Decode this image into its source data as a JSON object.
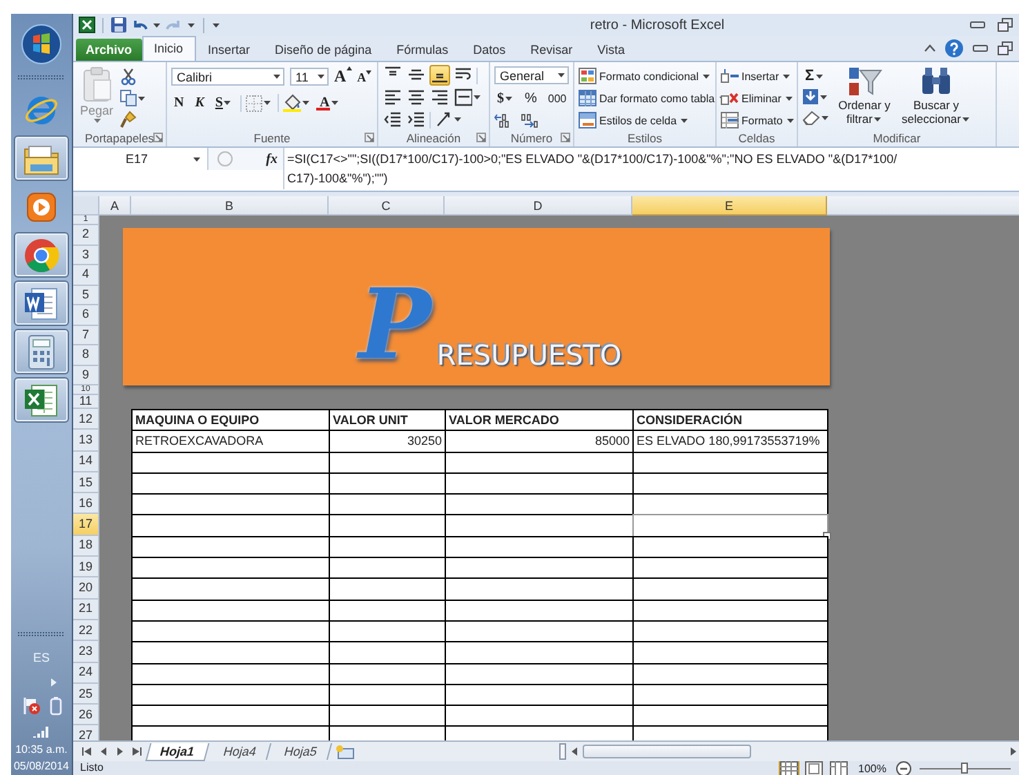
{
  "taskbar": {
    "items": [
      {
        "kind": "start",
        "running": false
      },
      {
        "kind": "browser",
        "running": false
      },
      {
        "kind": "folder",
        "running": true
      },
      {
        "kind": "media",
        "running": false
      },
      {
        "kind": "chrome",
        "running": true
      },
      {
        "kind": "word",
        "running": true
      },
      {
        "kind": "calculator",
        "running": true
      },
      {
        "kind": "spreadsheet",
        "running": true
      }
    ],
    "tray": {
      "language": "ES",
      "time": "10:35 a.m.",
      "date": "05/08/2014"
    }
  },
  "title_bar": {
    "title": "retro - Microsoft Excel",
    "quick_access": [
      {
        "kind": "save",
        "disabled": false
      },
      {
        "kind": "undo",
        "disabled": false
      },
      {
        "kind": "redo",
        "disabled": true
      }
    ]
  },
  "ribbon_tabs": [
    {
      "label": "Archivo",
      "kind": "file",
      "selected": false
    },
    {
      "label": "Inicio",
      "kind": "tab",
      "selected": true
    },
    {
      "label": "Insertar",
      "kind": "tab",
      "selected": false
    },
    {
      "label": "Diseño de página",
      "kind": "tab",
      "selected": false
    },
    {
      "label": "Fórmulas",
      "kind": "tab",
      "selected": false
    },
    {
      "label": "Datos",
      "kind": "tab",
      "selected": false
    },
    {
      "label": "Revisar",
      "kind": "tab",
      "selected": false
    },
    {
      "label": "Vista",
      "kind": "tab",
      "selected": false
    }
  ],
  "ribbon": {
    "clipboard": {
      "paste": "Pegar",
      "paste_disabled": true,
      "label": "Portapapeles"
    },
    "font": {
      "name": "Calibri",
      "size": "11",
      "grow": "A",
      "shrink": "A",
      "bold": "N",
      "italic": "K",
      "underline": "S",
      "color_letter": "A",
      "label": "Fuente"
    },
    "alignment": {
      "buttons": [
        {
          "kind": "top",
          "selected": false
        },
        {
          "kind": "middle",
          "selected": false
        },
        {
          "kind": "bottom",
          "selected": true
        },
        {
          "kind": "wrap",
          "selected": false
        },
        {
          "kind": "left",
          "selected": false
        },
        {
          "kind": "center",
          "selected": false
        },
        {
          "kind": "right",
          "selected": false
        },
        {
          "kind": "merge",
          "selected": false
        },
        {
          "kind": "outdent",
          "selected": false
        },
        {
          "kind": "indent",
          "selected": false
        },
        {
          "kind": "orientation",
          "selected": false
        }
      ],
      "label": "Alineación"
    },
    "number": {
      "format": "General",
      "currency": "$",
      "percent": "%",
      "thousands": "000",
      "label": "Número"
    },
    "styles": {
      "items": [
        "Formato condicional",
        "Dar formato como tabla",
        "Estilos de celda"
      ],
      "label": "Estilos"
    },
    "cells": {
      "items": [
        "Insertar",
        "Eliminar",
        "Formato"
      ],
      "label": "Celdas"
    },
    "editing": {
      "sum": "Σ",
      "sort": "Ordenar y filtrar",
      "find": "Buscar y seleccionar",
      "label": "Modificar"
    }
  },
  "formula_bar": {
    "name_box": "E17",
    "function_label": "fx",
    "formula": [
      "=SI(C17<>\"\";SI((D17*100/C17)-100>0;\"ES ELVADO \"&(D17*100/C17)-100&\"%\";\"NO ES ELVADO \"&(D17*100/",
      "C17)-100&\"%\");\"\")"
    ]
  },
  "columns": [
    {
      "label": "A",
      "selected": false
    },
    {
      "label": "B",
      "selected": false
    },
    {
      "label": "C",
      "selected": false
    },
    {
      "label": "D",
      "selected": false
    },
    {
      "label": "E",
      "selected": true
    }
  ],
  "rows": [
    {
      "label": "1",
      "selected": false
    },
    {
      "label": "2",
      "selected": false
    },
    {
      "label": "3",
      "selected": false
    },
    {
      "label": "4",
      "selected": false
    },
    {
      "label": "5",
      "selected": false
    },
    {
      "label": "6",
      "selected": false
    },
    {
      "label": "7",
      "selected": false
    },
    {
      "label": "8",
      "selected": false
    },
    {
      "label": "9",
      "selected": false
    },
    {
      "label": "10",
      "selected": false
    },
    {
      "label": "11",
      "selected": false
    },
    {
      "label": "12",
      "selected": false
    },
    {
      "label": "13",
      "selected": false
    },
    {
      "label": "14",
      "selected": false
    },
    {
      "label": "15",
      "selected": false
    },
    {
      "label": "16",
      "selected": false
    },
    {
      "label": "17",
      "selected": true
    },
    {
      "label": "18",
      "selected": false
    },
    {
      "label": "19",
      "selected": false
    },
    {
      "label": "20",
      "selected": false
    },
    {
      "label": "21",
      "selected": false
    },
    {
      "label": "22",
      "selected": false
    },
    {
      "label": "23",
      "selected": false
    },
    {
      "label": "24",
      "selected": false
    },
    {
      "label": "25",
      "selected": false
    },
    {
      "label": "26",
      "selected": false
    },
    {
      "label": "27",
      "selected": false
    }
  ],
  "banner": {
    "initial": "P",
    "word": "RESUPUESTO"
  },
  "table": {
    "header": [
      "MAQUINA O EQUIPO",
      "VALOR UNIT",
      "VALOR MERCADO",
      "CONSIDERACIÓN"
    ],
    "rows": [
      [
        {
          "text": "RETROEXCAVADORA",
          "kind": "text"
        },
        {
          "text": "30250",
          "kind": "number"
        },
        {
          "text": "85000",
          "kind": "number"
        },
        {
          "text": "ES ELVADO 180,99173553719%",
          "kind": "text"
        }
      ]
    ]
  },
  "sheet_tabs": [
    {
      "label": "Hoja1",
      "selected": true
    },
    {
      "label": "Hoja4",
      "selected": false
    },
    {
      "label": "Hoja5",
      "selected": false
    }
  ],
  "status_bar": {
    "status": "Listo",
    "views": [
      {
        "kind": "normal",
        "selected": true
      },
      {
        "kind": "layout",
        "selected": false
      },
      {
        "kind": "break",
        "selected": false
      }
    ],
    "zoom": "100%",
    "zoom_slider": {
      "level": 0.5
    }
  }
}
